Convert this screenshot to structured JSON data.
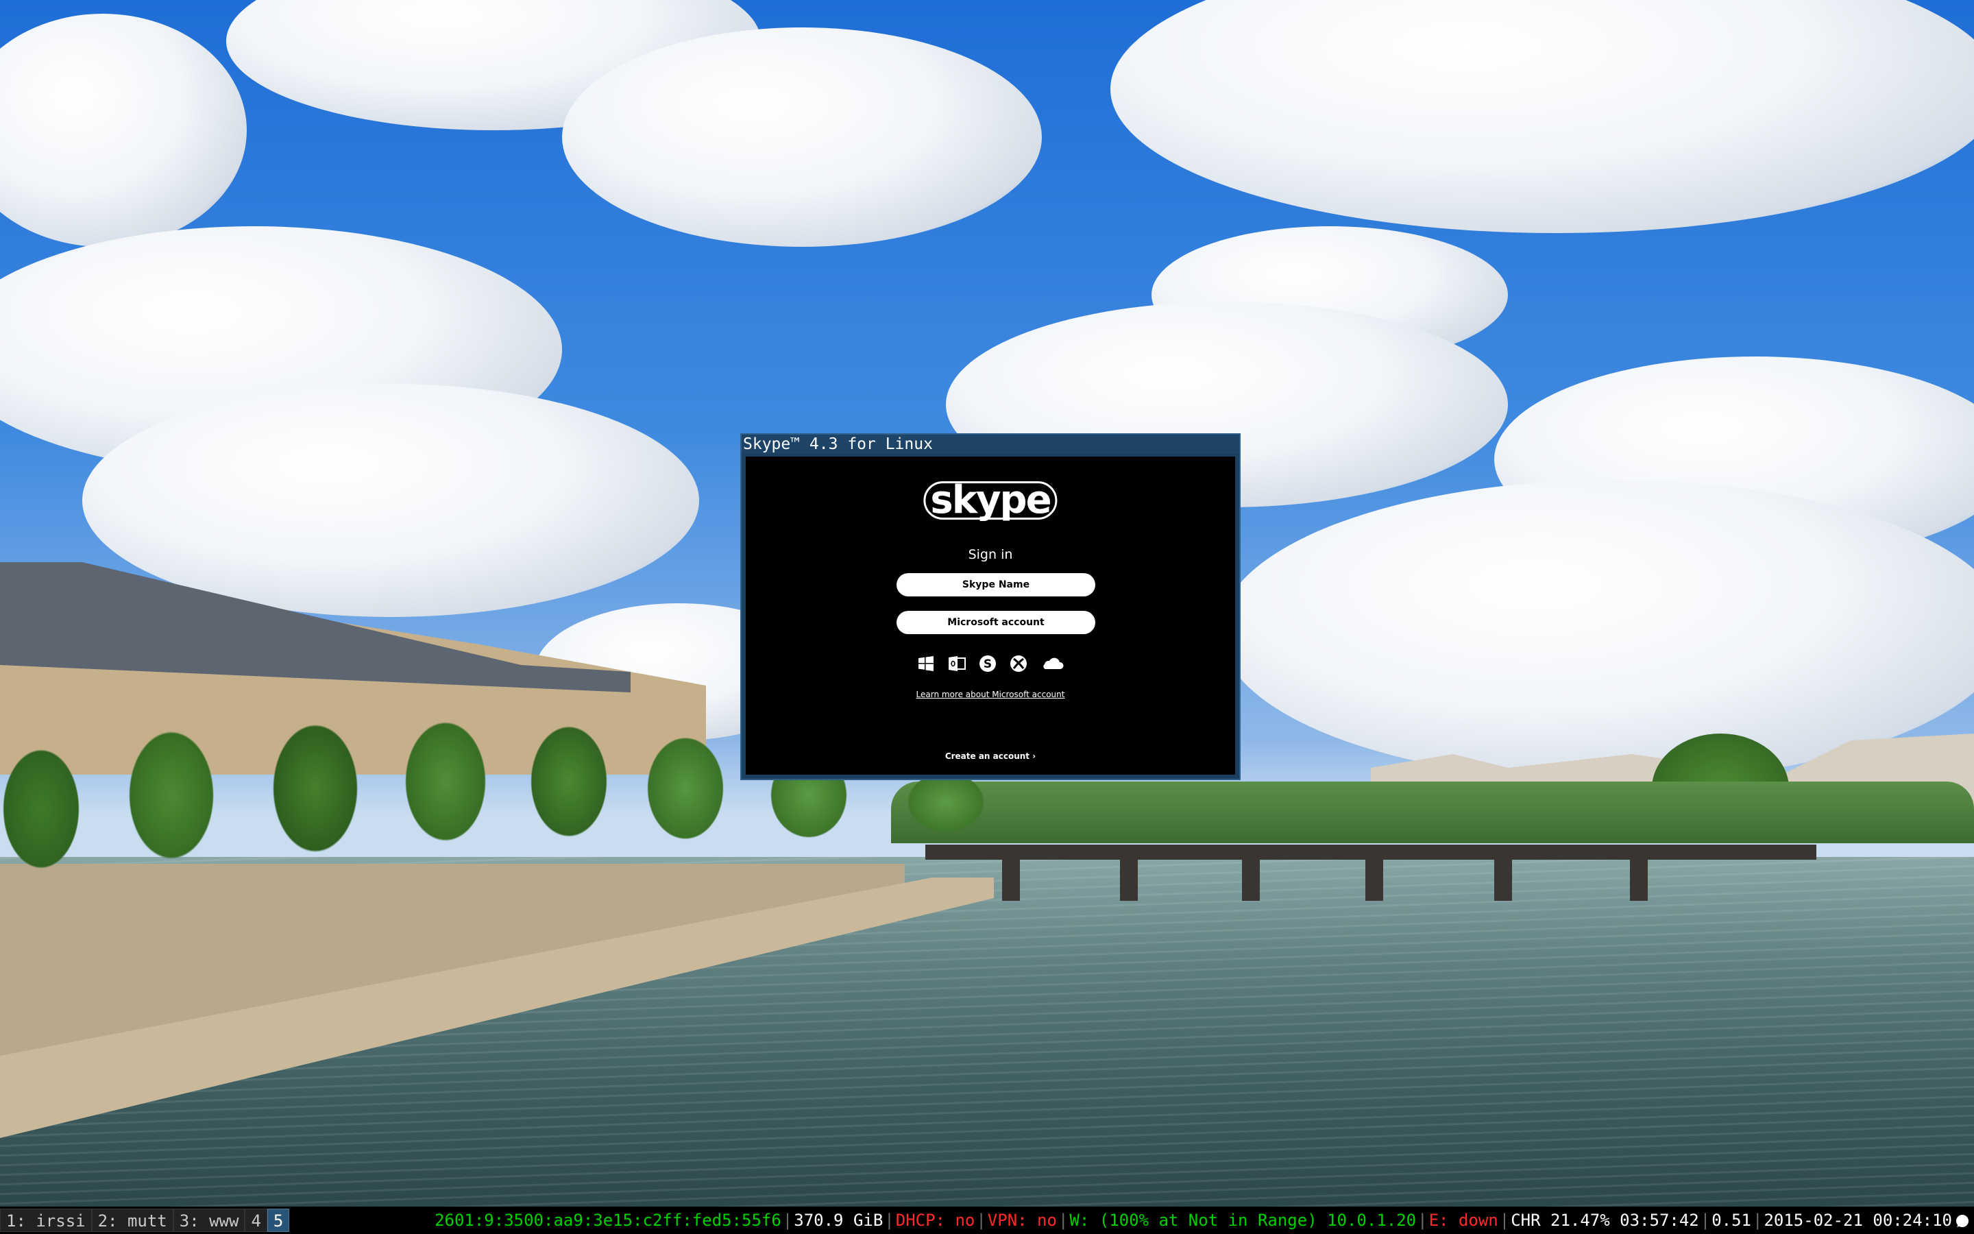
{
  "window": {
    "title": "Skype™ 4.3 for Linux",
    "logo_text": "skype",
    "sign_in_label": "Sign in",
    "skype_name_button": "Skype Name",
    "microsoft_account_button": "Microsoft account",
    "ms_service_icons": [
      "windows-icon",
      "outlook-icon",
      "skype-icon",
      "xbox-icon",
      "onedrive-icon"
    ],
    "learn_more_link": "Learn more about Microsoft account",
    "create_account_link": "Create an account ›"
  },
  "statusbar": {
    "workspaces": [
      {
        "label": "1: irssi",
        "active": false
      },
      {
        "label": "2: mutt",
        "active": false
      },
      {
        "label": "3: www",
        "active": false
      },
      {
        "label": "4",
        "active": false
      },
      {
        "label": "5",
        "active": true
      }
    ],
    "ipv6": "2601:9:3500:aa9:3e15:c2ff:fed5:55f6",
    "disk": "370.9 GiB",
    "dhcp": "DHCP: no",
    "vpn": "VPN: no",
    "wifi": "W: (100% at Not in Range) 10.0.1.20",
    "ethernet": "E: down",
    "battery": "CHR 21.47% 03:57:42",
    "load": "0.51",
    "datetime": "2015-02-21 00:24:10"
  },
  "colors": {
    "status_ok": "#00d000",
    "status_bad": "#ff2a2a",
    "workspace_active": "#285577",
    "window_frame": "#1d4467"
  }
}
